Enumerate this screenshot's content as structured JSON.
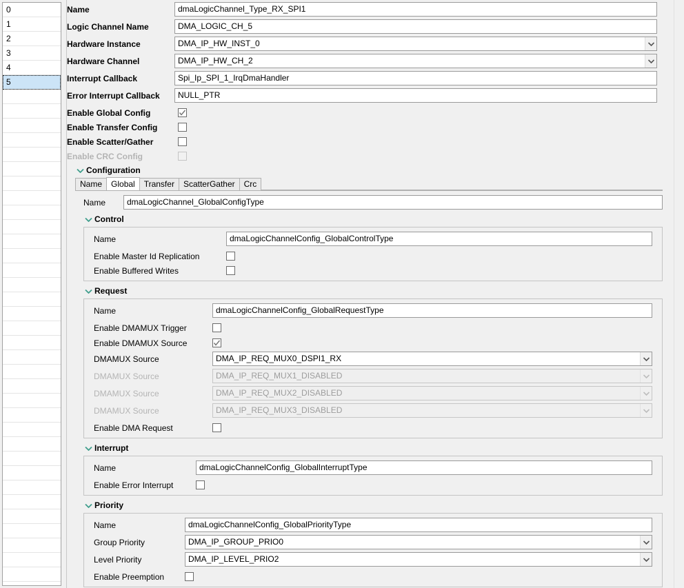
{
  "index_list": {
    "items": [
      "0",
      "1",
      "2",
      "3",
      "4",
      "5"
    ],
    "selected": "5",
    "blank_rows": 9
  },
  "top_fields": [
    {
      "label": "Name",
      "value": "dmaLogicChannel_Type_RX_SPI1",
      "type": "text",
      "disabled": false
    },
    {
      "label": "Logic Channel Name",
      "value": "DMA_LOGIC_CH_5",
      "type": "text",
      "disabled": false
    },
    {
      "label": "Hardware Instance",
      "value": "DMA_IP_HW_INST_0",
      "type": "combo",
      "disabled": false
    },
    {
      "label": "Hardware Channel",
      "value": "DMA_IP_HW_CH_2",
      "type": "combo",
      "disabled": false
    },
    {
      "label": "Interrupt Callback",
      "value": "Spi_Ip_SPI_1_IrqDmaHandler",
      "type": "text",
      "disabled": false
    },
    {
      "label": "Error Interrupt Callback",
      "value": "NULL_PTR",
      "type": "text",
      "disabled": false
    }
  ],
  "top_checkboxes": [
    {
      "label": "Enable Global Config",
      "checked": true,
      "disabled": false
    },
    {
      "label": "Enable Transfer Config",
      "checked": false,
      "disabled": false
    },
    {
      "label": "Enable Scatter/Gather",
      "checked": false,
      "disabled": false
    },
    {
      "label": "Enable CRC Config",
      "checked": false,
      "disabled": true
    }
  ],
  "configuration": {
    "section_title": "Configuration",
    "tabs": [
      {
        "label": "Name",
        "active": false
      },
      {
        "label": "Global",
        "active": true
      },
      {
        "label": "Transfer",
        "active": false
      },
      {
        "label": "ScatterGather",
        "active": false
      },
      {
        "label": "Crc",
        "active": false
      }
    ],
    "name_label": "Name",
    "name_value": "dmaLogicChannel_GlobalConfigType"
  },
  "control": {
    "section_title": "Control",
    "name_label": "Name",
    "name_value": "dmaLogicChannelConfig_GlobalControlType",
    "checkboxes": [
      {
        "label": "Enable Master Id Replication",
        "checked": false,
        "disabled": false
      },
      {
        "label": "Enable Buffered Writes",
        "checked": false,
        "disabled": false
      }
    ]
  },
  "request": {
    "section_title": "Request",
    "name_label": "Name",
    "name_value": "dmaLogicChannelConfig_GlobalRequestType",
    "trigger_label": "Enable DMAMUX Trigger",
    "trigger_checked": false,
    "source_enable_label": "Enable DMAMUX Source",
    "source_enable_checked": true,
    "mux_sources": [
      {
        "label": "DMAMUX Source",
        "value": "DMA_IP_REQ_MUX0_DSPI1_RX",
        "disabled": false
      },
      {
        "label": "DMAMUX Source",
        "value": "DMA_IP_REQ_MUX1_DISABLED",
        "disabled": true
      },
      {
        "label": "DMAMUX Source",
        "value": "DMA_IP_REQ_MUX2_DISABLED",
        "disabled": true
      },
      {
        "label": "DMAMUX Source",
        "value": "DMA_IP_REQ_MUX3_DISABLED",
        "disabled": true
      }
    ],
    "dma_request_label": "Enable DMA Request",
    "dma_request_checked": false
  },
  "interrupt": {
    "section_title": "Interrupt",
    "name_label": "Name",
    "name_value": "dmaLogicChannelConfig_GlobalInterruptType",
    "error_label": "Enable Error Interrupt",
    "error_checked": false
  },
  "priority": {
    "section_title": "Priority",
    "name_label": "Name",
    "name_value": "dmaLogicChannelConfig_GlobalPriorityType",
    "group_label": "Group Priority",
    "group_value": "DMA_IP_GROUP_PRIO0",
    "level_label": "Level Priority",
    "level_value": "DMA_IP_LEVEL_PRIO2",
    "preempt_label": "Enable Preemption",
    "preempt_checked": false
  },
  "colors": {
    "chevron": "#3f9e8c",
    "selection": "#cce4f7",
    "field_border": "#9a9a9a",
    "panel_bg": "#f0f0f0",
    "disabled_text": "#9d9d9d"
  }
}
